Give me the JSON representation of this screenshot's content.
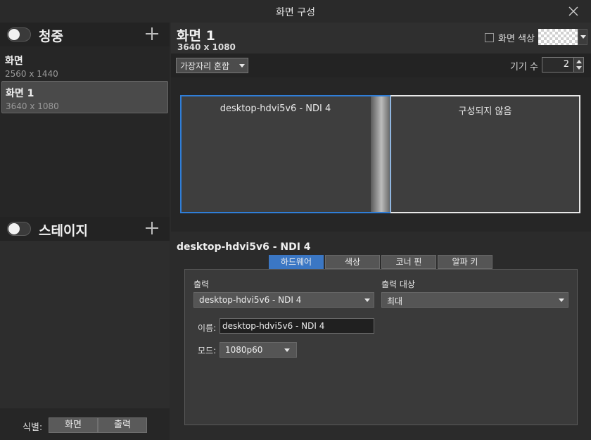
{
  "window": {
    "title": "화면 구성"
  },
  "audience": {
    "title": "청중",
    "items": [
      {
        "name": "화면",
        "res": "2560 x 1440"
      },
      {
        "name": "화면 1",
        "res": "3640 x 1080"
      }
    ]
  },
  "stage": {
    "title": "스테이지"
  },
  "identify": {
    "label": "식별:",
    "screen_btn": "화면",
    "output_btn": "출력"
  },
  "screen": {
    "name": "화면 1",
    "res": "3640 x 1080",
    "color_label": "화면 색상"
  },
  "toolbar": {
    "blend_label": "가장자리 혼합",
    "devices_label": "기기 수",
    "devices_count": "2"
  },
  "outputs": [
    {
      "label": "desktop-hdvi5v6 - NDI 4"
    },
    {
      "label": "구성되지 않음"
    }
  ],
  "props": {
    "device_title": "desktop-hdvi5v6 - NDI 4",
    "tabs": [
      "하드웨어",
      "색상",
      "코너 핀",
      "알파 키"
    ],
    "output_label": "출력",
    "output_value": "desktop-hdvi5v6 - NDI 4",
    "target_label": "출력 대상",
    "target_value": "최대",
    "name_label": "이름:",
    "name_value": "desktop-hdvi5v6 - NDI 4",
    "mode_label": "모드:",
    "mode_value": "1080p60"
  },
  "colors": {
    "accent": "#3b77c4",
    "selection_border": "#2f7ed8"
  },
  "icons": [
    "close-icon",
    "plus-icon",
    "toggle",
    "chevron-down-icon",
    "spinner"
  ]
}
